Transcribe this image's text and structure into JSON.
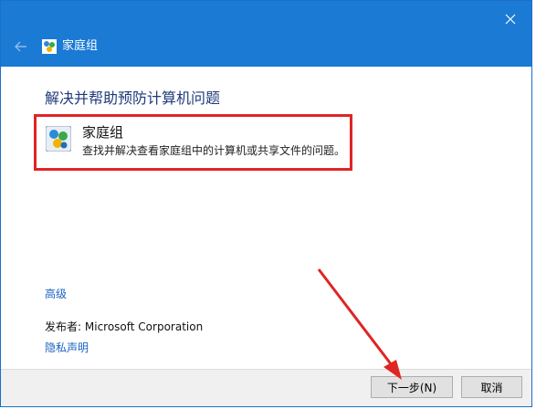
{
  "window": {
    "title": "家庭组",
    "accent_color": "#1a7ad4"
  },
  "content": {
    "heading": "解决并帮助预防计算机问题",
    "option": {
      "title": "家庭组",
      "description": "查找并解决查看家庭组中的计算机或共享文件的问题。",
      "icon": "homegroup-icon",
      "highlight_color": "#e02424"
    },
    "advanced_link": "高级",
    "publisher_label": "发布者:",
    "publisher_name": "Microsoft Corporation",
    "privacy_link": "隐私声明"
  },
  "footer": {
    "next_label": "下一步(N)",
    "cancel_label": "取消"
  },
  "annotation": {
    "arrow_color": "#e02424"
  }
}
